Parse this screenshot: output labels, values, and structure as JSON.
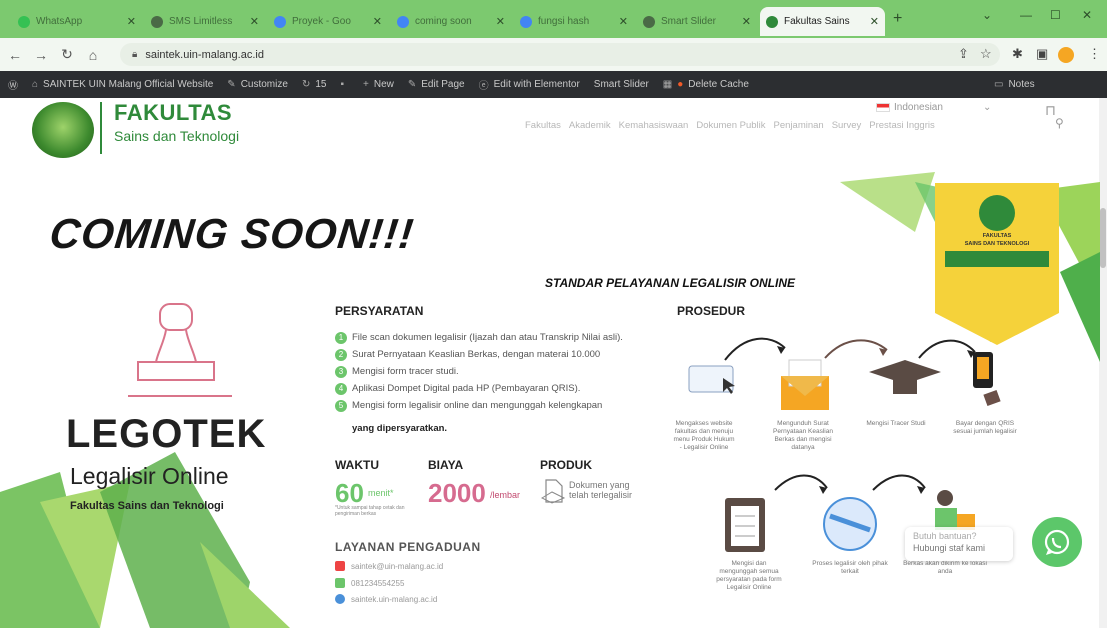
{
  "tabs": [
    {
      "title": "WhatsApp",
      "color": "#35c153"
    },
    {
      "title": "SMS Limitless",
      "color": "#4a6a46"
    },
    {
      "title": "Proyek - Goo",
      "color": "#4285f4"
    },
    {
      "title": "coming soon",
      "color": "#4285f4"
    },
    {
      "title": "fungsi hash",
      "color": "#4285f4"
    },
    {
      "title": "Smart Slider",
      "color": "#4a6a46"
    },
    {
      "title": "Fakultas Sains",
      "color": "#2f8a3a"
    }
  ],
  "address": {
    "url": "saintek.uin-malang.ac.id"
  },
  "wp_admin": {
    "site": "SAINTEK UIN Malang Official Website",
    "customize": "Customize",
    "updates": "15",
    "new": "New",
    "edit_page": "Edit Page",
    "elementor": "Edit with Elementor",
    "smart_slider": "Smart Slider",
    "delete_cache": "Delete Cache",
    "notes": "Notes"
  },
  "header": {
    "brand_top": "FAKULTAS",
    "brand_sub": "Sains dan Teknologi",
    "language": "Indonesian",
    "nav": [
      "Fakultas",
      "Akademik",
      "Kemahasiswaan",
      "Dokumen Publik",
      "Penjaminan",
      "Survey",
      "Prestasi Inggris"
    ]
  },
  "hero": {
    "coming": "COMING SOON!!!"
  },
  "standard": {
    "title": "STANDAR PELAYANAN LEGALISIR ONLINE"
  },
  "persyaratan": {
    "title": "PERSYARATAN",
    "items": [
      "File scan dokumen legalisir (Ijazah dan atau Transkrip Nilai asli).",
      "Surat Pernyataan Keaslian Berkas, dengan materai 10.000",
      "Mengisi form tracer studi.",
      "Aplikasi Dompet Digital pada HP (Pembayaran QRIS).",
      "Mengisi form legalisir online dan mengunggah kelengkapan"
    ],
    "tail": "yang dipersyaratkan."
  },
  "waktu": {
    "title": "WAKTU",
    "value": "60",
    "unit": "menit*",
    "note": "*Untuk sampai tahap cetak dan pengiriman berkas"
  },
  "biaya": {
    "title": "BIAYA",
    "value": "2000",
    "unit": "/lembar"
  },
  "produk": {
    "title": "PRODUK",
    "value": "Dokumen yang telah terlegalisir"
  },
  "layanan": {
    "title": "LAYANAN PENGADUAN",
    "email": "saintek@uin-malang.ac.id",
    "phone": "081234554255",
    "web": "saintek.uin-malang.ac.id"
  },
  "prosedur": {
    "title": "PROSEDUR",
    "steps": [
      "Mengakses website fakultas dan menuju menu Produk Hukum - Legalisir Online",
      "Mengunduh Surat Pernyataan Keaslian Berkas dan mengisi datanya",
      "Mengisi Tracer Studi",
      "Bayar dengan QRIS sesuai jumlah legalisir",
      "Mengisi dan mengunggah semua persyaratan pada form Legalisir Online",
      "Proses legalisir oleh pihak terkait",
      "Berkas akan dikirim ke lokasi anda"
    ]
  },
  "legotek": {
    "title": "LEGOTEK",
    "subtitle": "Legalisir Online",
    "faculty": "Fakultas Sains dan Teknologi"
  },
  "badge": {
    "line1": "FAKULTAS",
    "line2": "SAINS DAN TEKNOLOGI"
  },
  "help": {
    "question": "Butuh bantuan?",
    "cta": "Hubungi staf kami"
  },
  "colors": {
    "green": "#6cc56b",
    "pink": "#d66b8f",
    "tab_green": "#7cc96f",
    "wp_bar": "#2c2e31",
    "badge": "#f5d23a"
  }
}
